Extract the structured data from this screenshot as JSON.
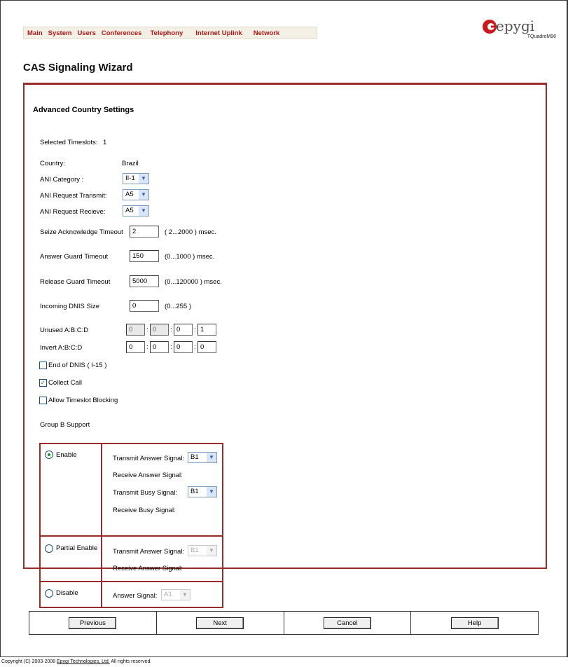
{
  "menu": [
    "Main",
    "System",
    "Users",
    "Conferences",
    "Telephony",
    "Internet Uplink",
    "Network"
  ],
  "logo": {
    "word": "epygi",
    "model": "TQuadroM96"
  },
  "page_title": "CAS Signaling Wizard",
  "section_title": "Advanced Country Settings",
  "selected_timeslots": {
    "label": "Selected Timeslots:",
    "value": "1"
  },
  "country": {
    "label": "Country:",
    "value": "Brazil"
  },
  "ani_category": {
    "label": "ANI Category :",
    "value": "II-1"
  },
  "ani_request_transmit": {
    "label": "ANI Request Transmit:",
    "value": "A5"
  },
  "ani_request_receive": {
    "label": "ANI Request Recieve:",
    "value": "A5"
  },
  "seize_ack_timeout": {
    "label": "Seize Acknowledge Timeout",
    "value": "2",
    "range": "( 2...2000 ) msec."
  },
  "answer_guard_timeout": {
    "label": "Answer Guard Timeout",
    "value": "150",
    "range": "(0...1000 ) msec."
  },
  "release_guard_timeout": {
    "label": "Release Guard Timeout",
    "value": "5000",
    "range": "(0...120000 ) msec."
  },
  "incoming_dnis_size": {
    "label": "Incoming DNIS Size",
    "value": "0",
    "range": "(0...255 )"
  },
  "unused_abcd": {
    "label": "Unused A:B:C:D",
    "values": [
      "0",
      "0",
      "0",
      "1"
    ]
  },
  "invert_abcd": {
    "label": "Invert A:B:C:D",
    "values": [
      "0",
      "0",
      "0",
      "0"
    ]
  },
  "end_of_dnis": {
    "label": "End of DNIS ( I-15 )",
    "checked": false
  },
  "collect_call": {
    "label": "Collect Call",
    "checked": true
  },
  "allow_timeslot_blocking": {
    "label": "Allow Timeslot Blocking",
    "checked": false
  },
  "group_b": {
    "label": "Group B Support",
    "enable": {
      "label": "Enable",
      "selected": true,
      "transmit_answer_label": "Transmit Answer Signal:",
      "transmit_answer_value": "B1",
      "receive_answer_label": "Receive Answer Signal:",
      "transmit_busy_label": "Transmit Busy Signal:",
      "transmit_busy_value": "B1",
      "receive_busy_label": "Receive Busy Signal:"
    },
    "partial": {
      "label": "Partial Enable",
      "selected": false,
      "transmit_answer_label": "Transmit Answer Signal:",
      "transmit_answer_value": "B1",
      "receive_answer_label": "Receive Answer Signal:"
    },
    "disable": {
      "label": "Disable",
      "selected": false,
      "answer_label": "Answer Signal:",
      "answer_value": "A1"
    }
  },
  "buttons": {
    "previous": "Previous",
    "next": "Next",
    "cancel": "Cancel",
    "help": "Help"
  },
  "footer": {
    "prefix": "Copyright (C) 2003-2008",
    "link": "Epygi Technologies, Ltd.",
    "suffix": "All rights reserved."
  },
  "colors": {
    "menu_text": "#b01818",
    "frame_border": "#9b2b2b",
    "check_green": "#2a8a2a"
  }
}
